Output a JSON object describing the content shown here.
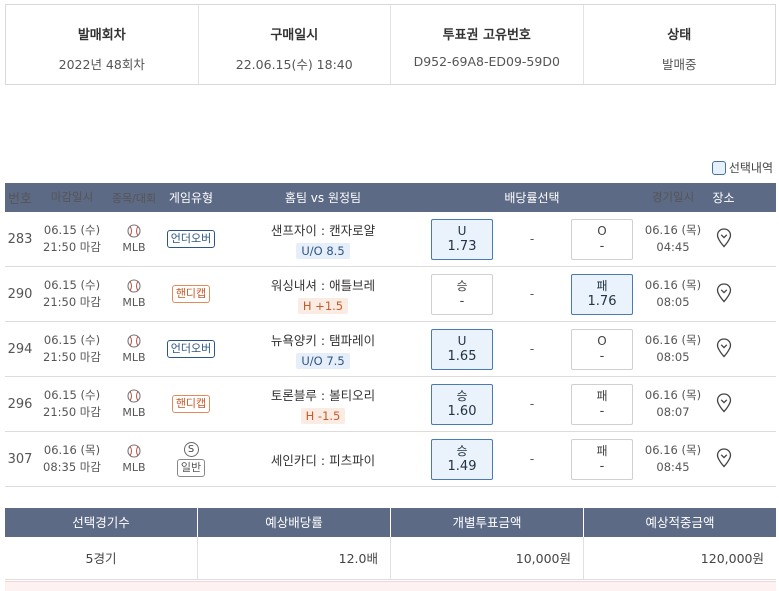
{
  "info": {
    "round_label": "발매회차",
    "round_value": "2022년 48회차",
    "purchase_label": "구매일시",
    "purchase_value": "22.06.15(수) 18:40",
    "ticket_label": "투표권 고유번호",
    "ticket_value": "D952-69A8-ED09-59D0",
    "status_label": "상태",
    "status_value": "발매중"
  },
  "legend": {
    "label": "선택내역"
  },
  "table_headers": {
    "no": "번호",
    "deadline": "마감일시",
    "sport": "종목/대회",
    "game_type": "게임유형",
    "matchup": "홈팀 vs 원정팀",
    "odds_select": "배당률선택",
    "game_date": "경기일시",
    "place": "장소"
  },
  "games": [
    {
      "no": "283",
      "deadline_date": "06.15 (수)",
      "deadline_time": "21:50 마감",
      "league": "MLB",
      "type_label": "언더오버",
      "type_kind": "ou",
      "home": "샌프자이",
      "away": "캔자로얄",
      "separator": ":",
      "sub": "U/O 8.5",
      "left_label": "U",
      "left_odds": "1.73",
      "left_selected": true,
      "mid": "-",
      "right_label": "O",
      "right_odds": "-",
      "right_selected": false,
      "game_date": "06.16 (목)",
      "game_time": "04:45"
    },
    {
      "no": "290",
      "deadline_date": "06.15 (수)",
      "deadline_time": "21:50 마감",
      "league": "MLB",
      "type_label": "핸디캡",
      "type_kind": "hc",
      "home": "워싱내셔",
      "away": "애틀브레",
      "separator": ":",
      "sub": "H +1.5",
      "left_label": "승",
      "left_odds": "-",
      "left_selected": false,
      "mid": "-",
      "right_label": "패",
      "right_odds": "1.76",
      "right_selected": true,
      "game_date": "06.16 (목)",
      "game_time": "08:05"
    },
    {
      "no": "294",
      "deadline_date": "06.15 (수)",
      "deadline_time": "21:50 마감",
      "league": "MLB",
      "type_label": "언더오버",
      "type_kind": "ou",
      "home": "뉴욕양키",
      "away": "탬파레이",
      "separator": ":",
      "sub": "U/O 7.5",
      "left_label": "U",
      "left_odds": "1.65",
      "left_selected": true,
      "mid": "-",
      "right_label": "O",
      "right_odds": "-",
      "right_selected": false,
      "game_date": "06.16 (목)",
      "game_time": "08:05"
    },
    {
      "no": "296",
      "deadline_date": "06.15 (수)",
      "deadline_time": "21:50 마감",
      "league": "MLB",
      "type_label": "핸디캡",
      "type_kind": "hc",
      "home": "토론블루",
      "away": "볼티오리",
      "separator": ":",
      "sub": "H -1.5",
      "left_label": "승",
      "left_odds": "1.60",
      "left_selected": true,
      "mid": "-",
      "right_label": "패",
      "right_odds": "-",
      "right_selected": false,
      "game_date": "06.16 (목)",
      "game_time": "08:07"
    },
    {
      "no": "307",
      "deadline_date": "06.16 (목)",
      "deadline_time": "08:35 마감",
      "league": "MLB",
      "type_label": "일반",
      "type_kind": "gen",
      "type_extra": "S",
      "home": "세인카디",
      "away": "피츠파이",
      "separator": ":",
      "sub": "",
      "left_label": "승",
      "left_odds": "1.49",
      "left_selected": true,
      "mid": "-",
      "right_label": "패",
      "right_odds": "-",
      "right_selected": false,
      "game_date": "06.16 (목)",
      "game_time": "08:45"
    }
  ],
  "summary": {
    "h_count": "선택경기수",
    "h_odds": "예상배당률",
    "h_amount": "개별투표금액",
    "h_expected": "예상적중금액",
    "count": "5경기",
    "odds": "12.0배",
    "amount": "10,000원",
    "expected": "120,000원"
  },
  "icons": {
    "sport": "baseball-icon",
    "place": "map-pin-icon"
  },
  "colors": {
    "header_bg": "#5c6a86",
    "selected_border": "#4a7ab3",
    "ou_tag": "#2c5585",
    "hc_tag": "#c65b2a"
  }
}
